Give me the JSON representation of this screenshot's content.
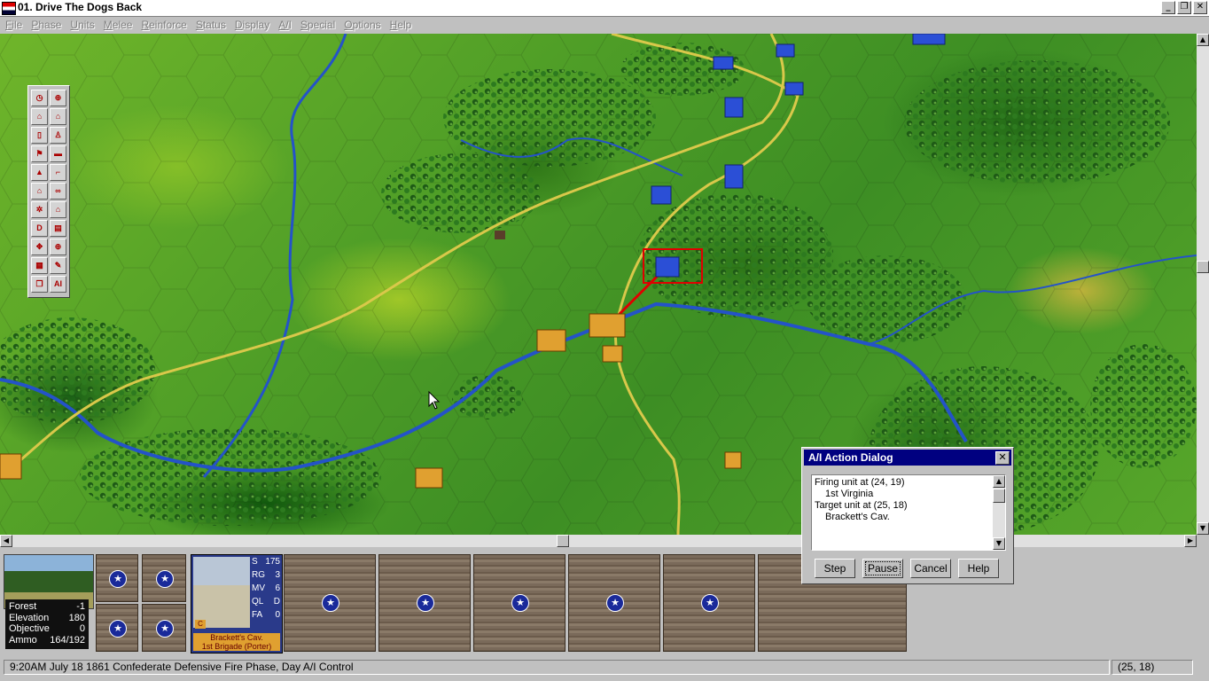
{
  "window": {
    "title": "01. Drive The Dogs Back",
    "buttons": [
      "_",
      "❐",
      "✕"
    ]
  },
  "menu": [
    "File",
    "Phase",
    "Units",
    "Melee",
    "Reinforce",
    "Status",
    "Display",
    "A/I",
    "Special",
    "Options",
    "Help"
  ],
  "toolbox": {
    "ai_label": "AI",
    "d_label": "D"
  },
  "terrain": {
    "rows": [
      {
        "label": "Forest",
        "value": "-1"
      },
      {
        "label": "Elevation",
        "value": "180"
      },
      {
        "label": "Objective",
        "value": "0"
      },
      {
        "label": "Ammo",
        "value": "164/192"
      }
    ]
  },
  "unit": {
    "stats": [
      {
        "label": "S",
        "value": "175"
      },
      {
        "label": "RG",
        "value": "3"
      },
      {
        "label": "MV",
        "value": "6"
      },
      {
        "label": "QL",
        "value": "D"
      },
      {
        "label": "FA",
        "value": "0"
      }
    ],
    "name": "Brackett's Cav.",
    "brigade": "1st Brigade (Porter)",
    "badge": "C"
  },
  "status": {
    "message": "9:20AM July 18 1861 Confederate Defensive Fire Phase, Day A/I Control",
    "coords": "(25, 18)"
  },
  "dialog": {
    "title": "A/I Action Dialog",
    "lines": [
      "Firing unit at (24, 19)",
      "1st Virginia",
      "Target unit at (25, 18)",
      "Brackett's Cav."
    ],
    "buttons": {
      "step": "Step",
      "pause": "Pause",
      "cancel": "Cancel",
      "help": "Help"
    }
  },
  "colors": {
    "union": "#2b4fd6",
    "confederate": "#e0a030",
    "target_box": "#e00000"
  }
}
